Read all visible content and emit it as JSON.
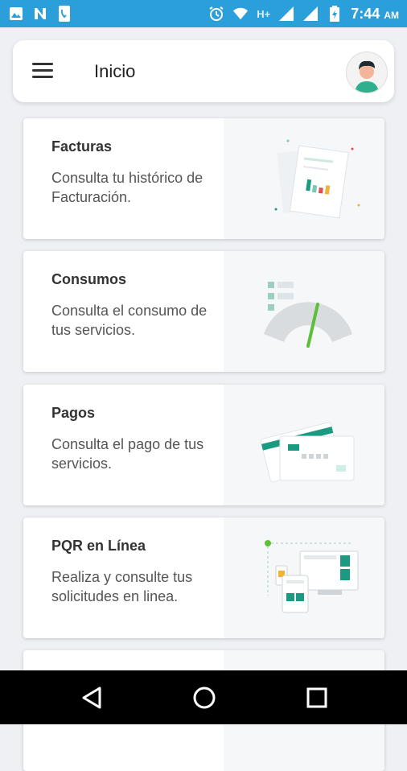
{
  "status_bar": {
    "network_label": "H+",
    "time": "7:44",
    "ampm": "AM",
    "color": "#2b9fd9",
    "icons": [
      "image-icon",
      "n-icon",
      "phone-icon",
      "alarm-icon",
      "wifi-icon",
      "signal-icon",
      "battery-icon"
    ]
  },
  "header": {
    "title": "Inicio",
    "menu_icon": "hamburger-menu-icon",
    "avatar_icon": "user-avatar-icon"
  },
  "cards": [
    {
      "title": "Facturas",
      "description": "Consulta tu histórico de Facturación.",
      "illustration": "invoice-chart-illustration"
    },
    {
      "title": "Consumos",
      "description": "Consulta el consumo de tus servicios.",
      "illustration": "gauge-illustration"
    },
    {
      "title": "Pagos",
      "description": "Consulta el pago de tus servicios.",
      "illustration": "payment-cards-illustration"
    },
    {
      "title": "PQR en Línea",
      "description": "Realiza y consulte tus solicitudes en linea.",
      "illustration": "devices-illustration"
    }
  ],
  "accent_green": "#1a9a80",
  "nav_bar": {
    "back_icon": "back-triangle-icon",
    "home_icon": "home-circle-icon",
    "recents_icon": "recents-square-icon"
  }
}
